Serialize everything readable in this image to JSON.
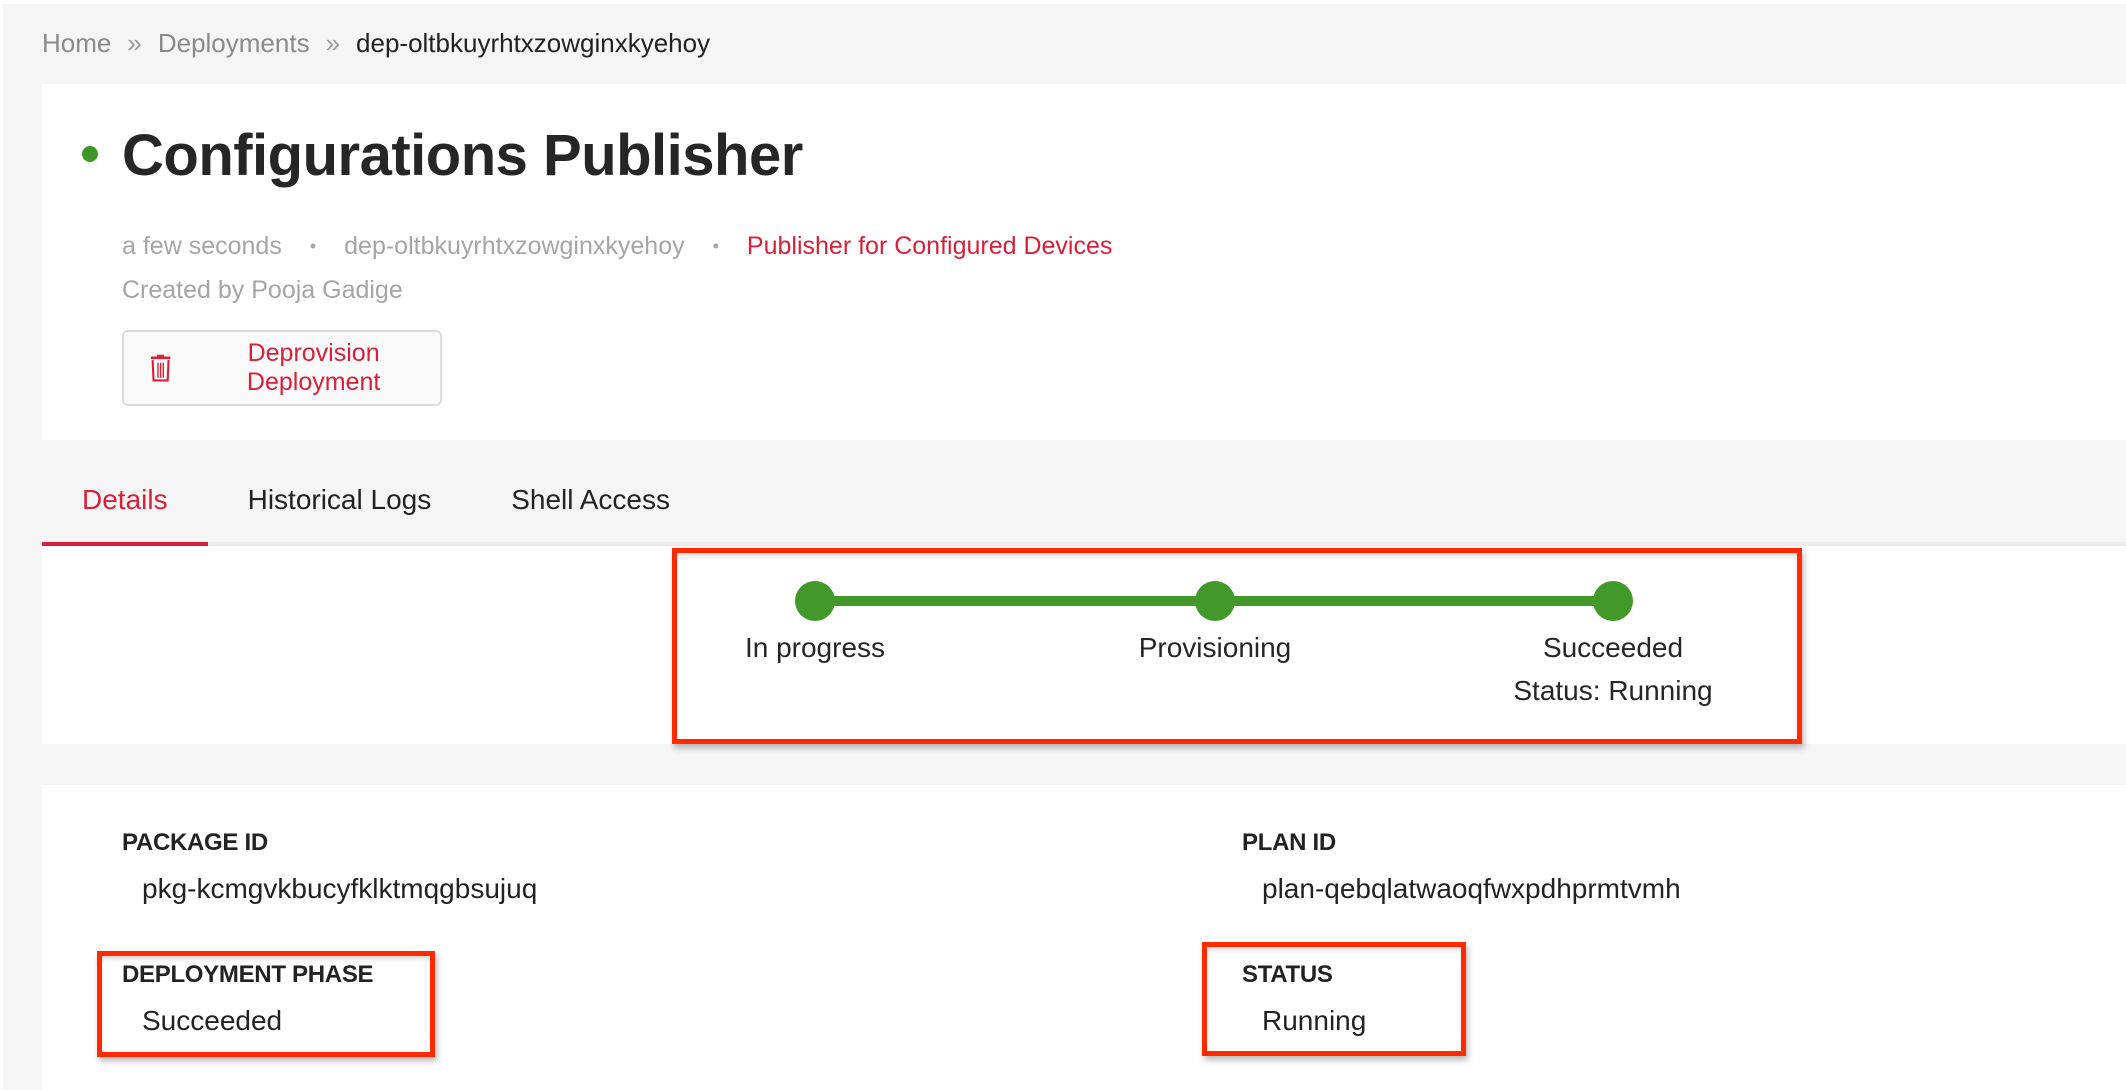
{
  "breadcrumb": {
    "items": [
      "Home",
      "Deployments"
    ],
    "separator": "»",
    "current": "dep-oltbkuyrhtxzowginxkyehoy"
  },
  "header": {
    "status_color": "#3f9627",
    "title": "Configurations Publisher",
    "meta": {
      "age": "a few seconds",
      "deployment_id": "dep-oltbkuyrhtxzowginxkyehoy",
      "description": "Publisher for Configured Devices",
      "separator": "•"
    },
    "created_by": "Created by Pooja Gadige",
    "deprovision_button": {
      "label": "Deprovision Deployment",
      "icon": "trash-icon"
    }
  },
  "tabs": [
    {
      "label": "Details",
      "active": true
    },
    {
      "label": "Historical Logs",
      "active": false
    },
    {
      "label": "Shell Access",
      "active": false
    }
  ],
  "stepper": {
    "color": "#43982a",
    "steps": [
      {
        "label": "In progress",
        "sublabel": ""
      },
      {
        "label": "Provisioning",
        "sublabel": ""
      },
      {
        "label": "Succeeded",
        "sublabel": "Status: Running"
      }
    ],
    "completed_steps": 3,
    "total_steps": 3
  },
  "details": {
    "package_id": {
      "label": "PACKAGE ID",
      "value": "pkg-kcmgvkbucyfklktmqgbsujuq"
    },
    "plan_id": {
      "label": "PLAN ID",
      "value": "plan-qebqlatwaoqfwxpdhprmtvmh"
    },
    "deployment_phase": {
      "label": "DEPLOYMENT PHASE",
      "value": "Succeeded"
    },
    "status": {
      "label": "STATUS",
      "value": "Running"
    }
  },
  "colors": {
    "accent": "#d9203a",
    "success": "#43982a",
    "annotation": "#ff2a00",
    "background": "#f5f5f5"
  }
}
